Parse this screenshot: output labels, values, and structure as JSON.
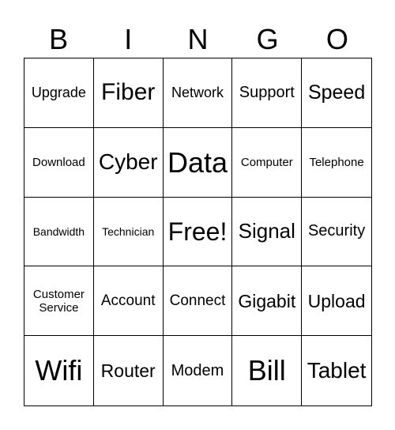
{
  "header": [
    "B",
    "I",
    "N",
    "G",
    "O"
  ],
  "cells": [
    "Upgrade",
    "Fiber",
    "Network",
    "Support",
    "Speed",
    "Download",
    "Cyber",
    "Data",
    "Computer",
    "Telephone",
    "Bandwidth",
    "Technician",
    "Free!",
    "Signal",
    "Security",
    "Customer Service",
    "Account",
    "Connect",
    "Gigabit",
    "Upload",
    "Wifi",
    "Router",
    "Modem",
    "Bill",
    "Tablet"
  ]
}
